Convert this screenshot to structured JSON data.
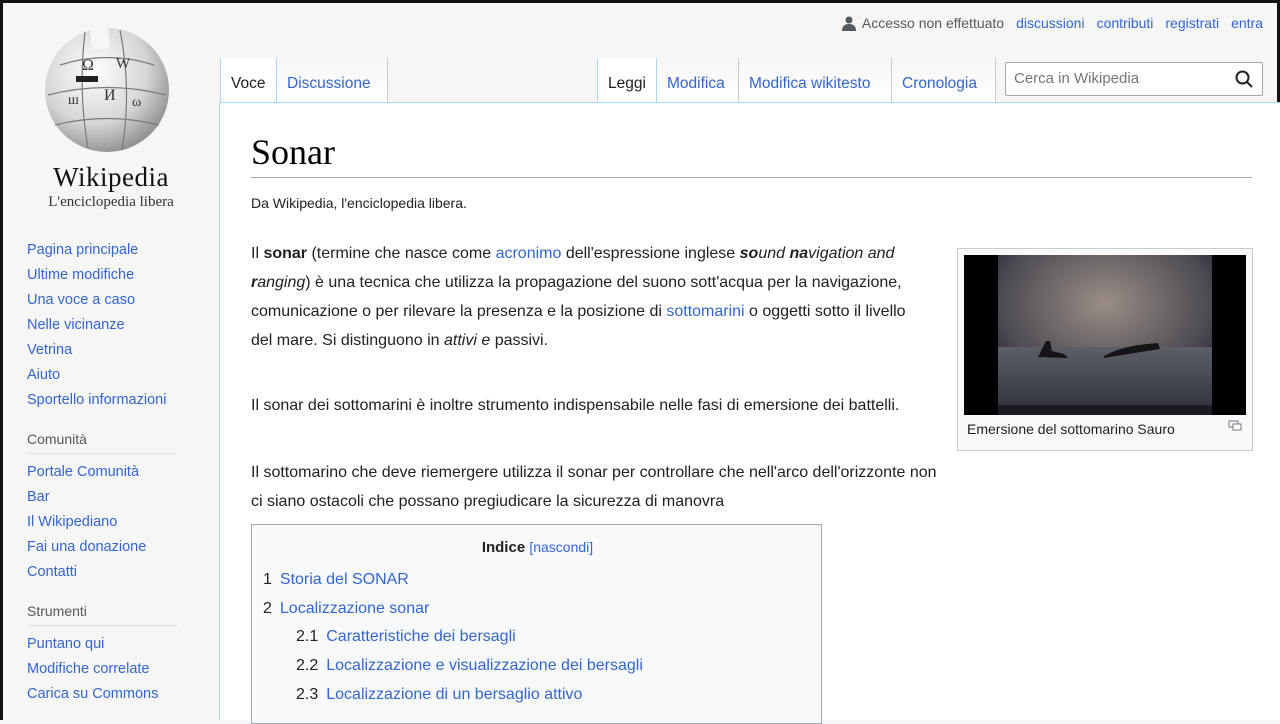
{
  "logo": {
    "wordmark": "Wikipedia",
    "tagline": "L'enciclopedia libera"
  },
  "personal": {
    "anon": "Accesso non effettuato",
    "links": [
      "discussioni",
      "contributi",
      "registrati",
      "entra"
    ]
  },
  "tabs": {
    "left": [
      "Voce",
      "Discussione"
    ],
    "right": [
      "Leggi",
      "Modifica",
      "Modifica wikitesto",
      "Cronologia"
    ]
  },
  "search": {
    "placeholder": "Cerca in Wikipedia"
  },
  "sidebar": {
    "nav": [
      "Pagina principale",
      "Ultime modifiche",
      "Una voce a caso",
      "Nelle vicinanze",
      "Vetrina",
      "Aiuto",
      "Sportello informazioni"
    ],
    "community_heading": "Comunità",
    "community": [
      "Portale Comunità",
      "Bar",
      "Il Wikipediano",
      "Fai una donazione",
      "Contatti"
    ],
    "tools_heading": "Strumenti",
    "tools": [
      "Puntano qui",
      "Modifiche correlate",
      "Carica su Commons"
    ]
  },
  "article": {
    "title": "Sonar",
    "site_tagline": "Da Wikipedia, l'enciclopedia libera.",
    "p1": {
      "t1": "Il ",
      "bold": "sonar",
      "t2": " (termine che nasce come ",
      "link1": "acronimo",
      "t3": " dell'espressione inglese ",
      "so": "so",
      "und": "und",
      "na": "na",
      "vigation": "vigation and ",
      "r": "r",
      "anging": "anging",
      "t4": ") è una tecnica che utilizza la propagazione del suono sott'acqua per la navigazione, comunicazione o per rilevare la presenza e la posizione di ",
      "link2": "sottomarini",
      "t5": " o oggetti sotto il livello del mare. Si distinguono in ",
      "attivi": "attivi e",
      "t6": " passivi."
    },
    "p2": "Il sonar dei sottomarini è inoltre strumento indispensabile nelle fasi di emersione dei battelli.",
    "p3": "Il sottomarino che deve riemergere utilizza il sonar per controllare che nell'arco dell'orizzonte non ci siano ostacoli che possano pregiudicare la sicurezza di manovra",
    "thumb_caption": "Emersione del sottomarino Sauro"
  },
  "toc": {
    "title": "Indice",
    "toggle": "[nascondi]",
    "items": [
      {
        "num": "1",
        "label": "Storia del SONAR"
      },
      {
        "num": "2",
        "label": "Localizzazione sonar"
      },
      {
        "num": "2.1",
        "label": "Caratteristiche dei bersagli"
      },
      {
        "num": "2.2",
        "label": "Localizzazione e visualizzazione dei bersagli"
      },
      {
        "num": "2.3",
        "label": "Localizzazione di un bersaglio attivo"
      }
    ]
  },
  "colors": {
    "link": "#3366cc",
    "border": "#a7d7f9",
    "text": "#202122"
  }
}
